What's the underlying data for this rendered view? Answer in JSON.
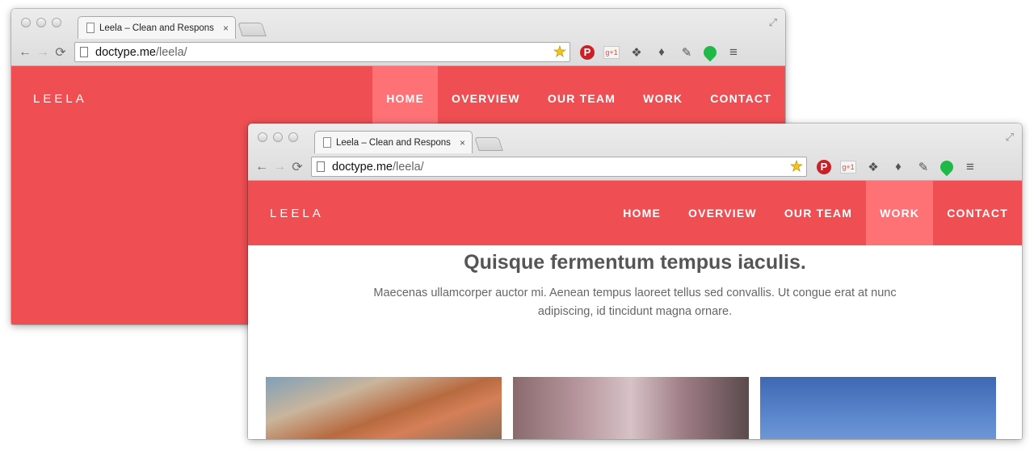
{
  "back_window": {
    "tab_title": "Leela – Clean and Respons",
    "url_host": "doctype.me",
    "url_path": "/leela/",
    "logo": "LEELA",
    "nav": [
      "HOME",
      "OVERVIEW",
      "OUR TEAM",
      "WORK",
      "CONTACT"
    ],
    "active_nav": "HOME"
  },
  "front_window": {
    "tab_title": "Leela – Clean and Respons",
    "url_host": "doctype.me",
    "url_path": "/leela/",
    "logo": "LEELA",
    "nav": [
      "HOME",
      "OVERVIEW",
      "OUR TEAM",
      "WORK",
      "CONTACT"
    ],
    "active_nav": "WORK",
    "headline": "Quisque fermentum tempus iaculis.",
    "lead": "Maecenas ullamcorper auctor mi. Aenean tempus laoreet tellus sed convallis. Ut congue erat at nunc adipiscing, id tincidunt magna ornare."
  },
  "icons": {
    "tab_close": "×",
    "back": "←",
    "forward": "→",
    "reload": "⟳",
    "star": "★",
    "pinterest": "P",
    "gplus": "g+1",
    "menu": "≡",
    "fullscreen": "⤢"
  },
  "colors": {
    "brand_red": "#ef4f53",
    "active_nav_bg": "#fe7276"
  }
}
